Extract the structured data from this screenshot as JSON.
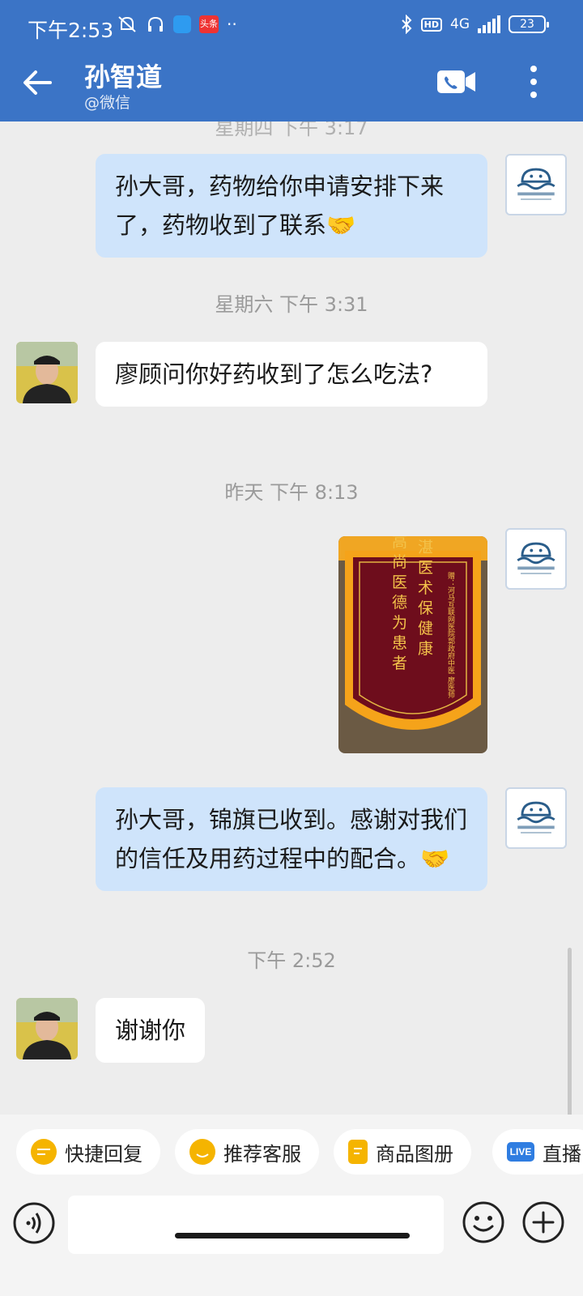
{
  "status_bar": {
    "time": "下午2:53",
    "toutiao_badge": "头条",
    "hd": "HD",
    "network": "4G",
    "battery": "23"
  },
  "header": {
    "title": "孙智道",
    "subtitle": "@微信"
  },
  "chat": {
    "cut_timestamp": "星期四 下午 3:17",
    "messages": [
      {
        "side": "mine",
        "text": "孙大哥，药物给你申请安排下来了，药物收到了联系🤝"
      },
      {
        "timestamp": "星期六  下午 3:31"
      },
      {
        "side": "theirs",
        "text": "廖顾问你好药收到了怎么吃法?"
      },
      {
        "timestamp": "昨天  下午 8:13"
      },
      {
        "side": "mine",
        "type": "image",
        "caption_lines": [
          "精湛医术保健康",
          "高尚医德为患者"
        ],
        "banner_recipient": "赠：河马互联网医院郭政府中医 廖医师"
      },
      {
        "side": "mine",
        "text": "孙大哥，锦旗已收到。感谢对我们的信任及用药过程中的配合。🤝"
      },
      {
        "timestamp": "下午 2:52"
      },
      {
        "side": "theirs",
        "text": "谢谢你"
      }
    ]
  },
  "self_avatar_text": "河马互联网医院",
  "quick_actions": [
    {
      "label": "快捷回复",
      "icon": "quick-reply-icon"
    },
    {
      "label": "推荐客服",
      "icon": "service-icon"
    },
    {
      "label": "商品图册",
      "icon": "catalog-icon"
    },
    {
      "label": "直播",
      "icon": "live-icon",
      "icon_text": "LIVE"
    }
  ],
  "input": {
    "value": "",
    "placeholder": ""
  },
  "colors": {
    "header": "#3b74c6",
    "bubble_mine": "#cfe4fb",
    "bubble_theirs": "#ffffff"
  }
}
